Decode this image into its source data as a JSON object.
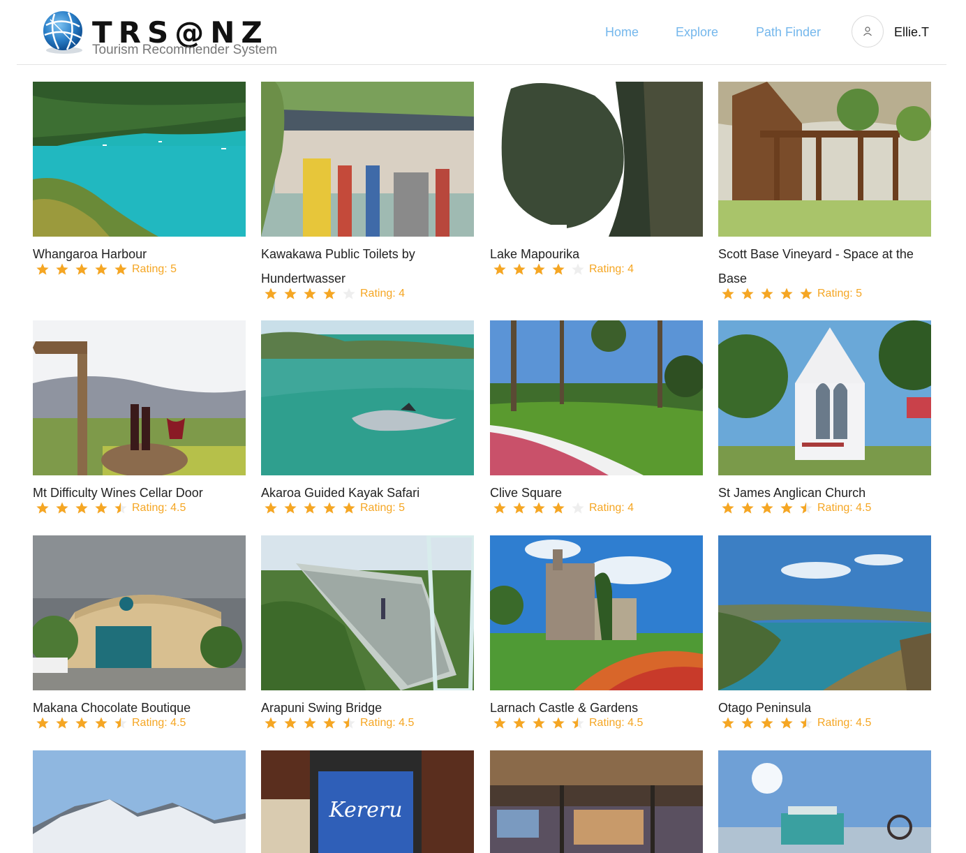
{
  "header": {
    "brand": "TRS@NZ",
    "subtitle": "Tourism Recommender System",
    "nav": [
      "Home",
      "Explore",
      "Path Finder"
    ],
    "username": "Ellie.T",
    "accent_color": "#74b7ec",
    "star_color": "#f5a623"
  },
  "places": [
    {
      "name": "Whangaroa Harbour",
      "stars": 5,
      "rating": "Rating: 5"
    },
    {
      "name": "Kawakawa Public Toilets by Hundertwasser",
      "stars": 4,
      "rating": "Rating: 4"
    },
    {
      "name": "Lake Mapourika",
      "stars": 4,
      "rating": "Rating: 4"
    },
    {
      "name": "Scott Base Vineyard - Space at the Base",
      "stars": 5,
      "rating": "Rating: 5"
    },
    {
      "name": "Mt Difficulty Wines Cellar Door",
      "stars": 4.5,
      "rating": "Rating: 4.5"
    },
    {
      "name": "Akaroa Guided Kayak Safari",
      "stars": 5,
      "rating": "Rating: 5"
    },
    {
      "name": "Clive Square",
      "stars": 4,
      "rating": "Rating: 4"
    },
    {
      "name": "St James Anglican Church",
      "stars": 4.5,
      "rating": "Rating: 4.5"
    },
    {
      "name": "Makana Chocolate Boutique",
      "stars": 4.5,
      "rating": "Rating: 4.5"
    },
    {
      "name": "Arapuni Swing Bridge",
      "stars": 4.5,
      "rating": "Rating: 4.5"
    },
    {
      "name": "Larnach Castle & Gardens",
      "stars": 4.5,
      "rating": "Rating: 4.5"
    },
    {
      "name": "Otago Peninsula",
      "stars": 4.5,
      "rating": "Rating: 4.5"
    }
  ]
}
